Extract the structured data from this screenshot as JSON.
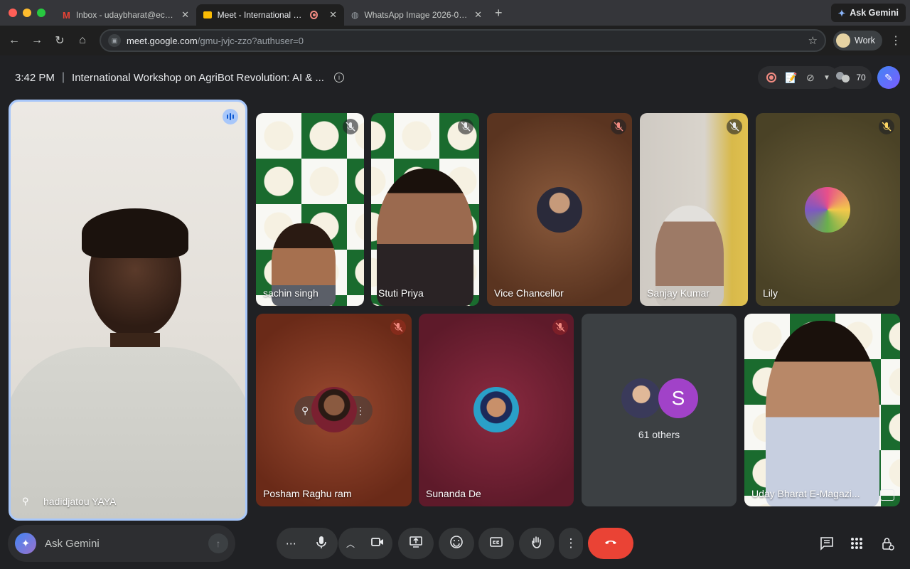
{
  "browser": {
    "tabs": [
      {
        "title": "Inbox - udaybharat@ecofasta",
        "icon": "gmail-icon",
        "active": false
      },
      {
        "title": "Meet - International Worksh",
        "icon": "meet-icon",
        "active": true
      },
      {
        "title": "WhatsApp Image 2026-06-05",
        "icon": "globe-icon",
        "active": false
      }
    ],
    "ask_gemini_label": "Ask Gemini",
    "url_host": "meet.google.com",
    "url_path": "/gmu-jvjc-zzo?authuser=0",
    "profile_label": "Work"
  },
  "meeting": {
    "time": "3:42 PM",
    "separator": "|",
    "title": "International Workshop on AgriBot Revolution: AI & ...",
    "participant_count": "70"
  },
  "main_speaker": {
    "name": "hadidjatou YAYA"
  },
  "tiles": [
    {
      "name": "sachin singh"
    },
    {
      "name": "Stuti Priya"
    },
    {
      "name": "Vice Chancellor"
    },
    {
      "name": "Sanjay Kumar"
    },
    {
      "name": "Lily"
    },
    {
      "name": "Posham Raghu ram"
    },
    {
      "name": "Sunanda De"
    },
    {
      "others_label": "61 others",
      "initial": "S"
    },
    {
      "name": "Uday Bharat E-Magazi..."
    }
  ],
  "bottom": {
    "ask_gemini_label": "Ask Gemini"
  },
  "colors": {
    "end_call": "#ea4335",
    "speaker_border": "#a8c7fa",
    "avatar_s": "#a142c8"
  }
}
